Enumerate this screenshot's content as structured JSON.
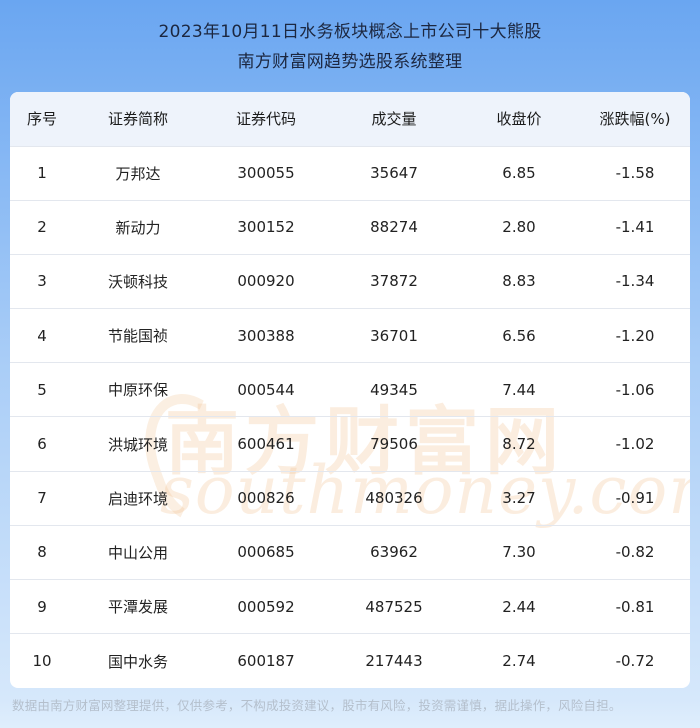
{
  "header": {
    "title_line1": "2023年10月11日水务板块概念上市公司十大熊股",
    "title_line2": "南方财富网趋势选股系统整理"
  },
  "table": {
    "columns": [
      "序号",
      "证券简称",
      "证券代码",
      "成交量",
      "收盘价",
      "涨跌幅(%)"
    ],
    "rows": [
      [
        "1",
        "万邦达",
        "300055",
        "35647",
        "6.85",
        "-1.58"
      ],
      [
        "2",
        "新动力",
        "300152",
        "88274",
        "2.80",
        "-1.41"
      ],
      [
        "3",
        "沃顿科技",
        "000920",
        "37872",
        "8.83",
        "-1.34"
      ],
      [
        "4",
        "节能国祯",
        "300388",
        "36701",
        "6.56",
        "-1.20"
      ],
      [
        "5",
        "中原环保",
        "000544",
        "49345",
        "7.44",
        "-1.06"
      ],
      [
        "6",
        "洪城环境",
        "600461",
        "79506",
        "8.72",
        "-1.02"
      ],
      [
        "7",
        "启迪环境",
        "000826",
        "480326",
        "3.27",
        "-0.91"
      ],
      [
        "8",
        "中山公用",
        "000685",
        "63962",
        "7.30",
        "-0.82"
      ],
      [
        "9",
        "平潭发展",
        "000592",
        "487525",
        "2.44",
        "-0.81"
      ],
      [
        "10",
        "国中水务",
        "600187",
        "217443",
        "2.74",
        "-0.72"
      ]
    ]
  },
  "watermark": {
    "cn": "南方财富网",
    "en": "southmoney.com"
  },
  "footer": {
    "disclaimer": "数据由南方财富网整理提供，仅供参考，不构成投资建议，股市有风险，投资需谨慎，据此操作，风险自担。"
  }
}
